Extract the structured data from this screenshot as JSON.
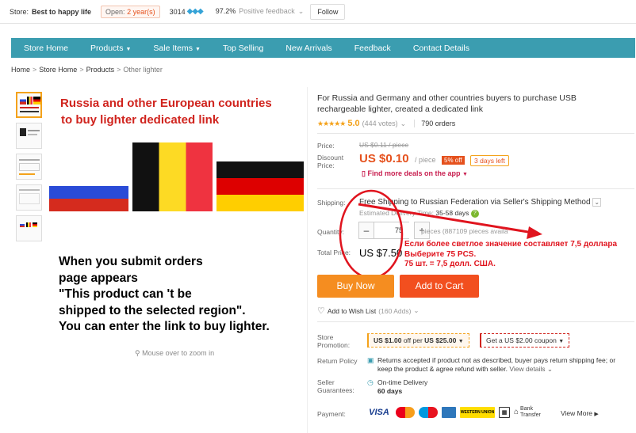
{
  "topbar": {
    "store_label": "Store:",
    "store_name": "Best to happy life",
    "open_label": "Open:",
    "open_value": "2 year(s)",
    "score": "3014",
    "feedback_pct": "97.2%",
    "feedback_label": "Positive feedback",
    "follow_label": "Follow"
  },
  "nav": {
    "items": [
      "Store Home",
      "Products",
      "Sale Items",
      "Top Selling",
      "New Arrivals",
      "Feedback",
      "Contact Details"
    ]
  },
  "breadcrumb": [
    "Home",
    "Store Home",
    "Products",
    "Other lighter"
  ],
  "image": {
    "headline_1": "Russia and other European countries",
    "headline_2": "to buy lighter dedicated link",
    "message_1": "When you submit orders",
    "message_2": "page appears",
    "message_3": "\"This product can 't be",
    "message_4": "shipped to the selected region\".",
    "message_5": "You can enter the link to buy lighter.",
    "zoom_hint": "Mouse over to zoom in"
  },
  "product": {
    "title": "For Russia and Germany and other countries buyers to purchase USB rechargeable lighter, created a dedicated link",
    "rating": "5.0",
    "votes": "(444 votes)",
    "orders": "790 orders",
    "price_label": "Price:",
    "old_price": "US $0.11 / piece",
    "discount_label_1": "Discount",
    "discount_label_2": "Price:",
    "discount_price": "US $0.10",
    "per_piece": "/ piece",
    "off_badge": "5% off",
    "days_left": "3 days left",
    "deals": "Find more deals on the app",
    "shipping_label": "Shipping:",
    "shipping_text": "Free Shipping to Russian Federation via Seller's Shipping Method",
    "delivery_label": "Estimated Delivery Time:",
    "delivery_value": "35-58 days",
    "quantity_label": "Quantity:",
    "quantity_value": "75",
    "available": "pieces (887109 pieces availa",
    "total_label": "Total Price:",
    "total_value": "US $7.50",
    "buy_now": "Buy Now",
    "add_to_cart": "Add to Cart",
    "wish_label": "Add to Wish List",
    "wish_count": "(160 Adds)",
    "promo_label_1": "Store",
    "promo_label_2": "Promotion:",
    "coupon_1_a": "US $1.00",
    "coupon_1_b": "off per",
    "coupon_1_c": "US $25.00",
    "coupon_2": "Get a US $2.00 coupon",
    "return_label": "Return Policy",
    "return_text": "Returns accepted if product not as described, buyer pays return shipping fee; or keep the product & agree refund with seller.",
    "return_link": "View details",
    "seller_label_1": "Seller",
    "seller_label_2": "Guarantees:",
    "ontime_label": "On-time Delivery",
    "ontime_days": "60 days",
    "payment_label": "Payment:",
    "view_more": "View More"
  },
  "payment_methods": [
    "VISA",
    "MasterCard",
    "Maestro",
    "AmEx",
    "WESTERN UNION",
    "WebMoney",
    "Bank Transfer"
  ],
  "annotation": {
    "line_1": "Если более светлое значение составляет 7,5 доллара",
    "line_2": "Выберите 75 PCS.",
    "line_3": "75 шт. = 7,5 долл. США."
  },
  "colors": {
    "nav": "#3b9db0",
    "price": "#e5511d",
    "buy_now": "#f58d20",
    "add_to_cart": "#f24f1f",
    "annotation": "#e0141e"
  }
}
